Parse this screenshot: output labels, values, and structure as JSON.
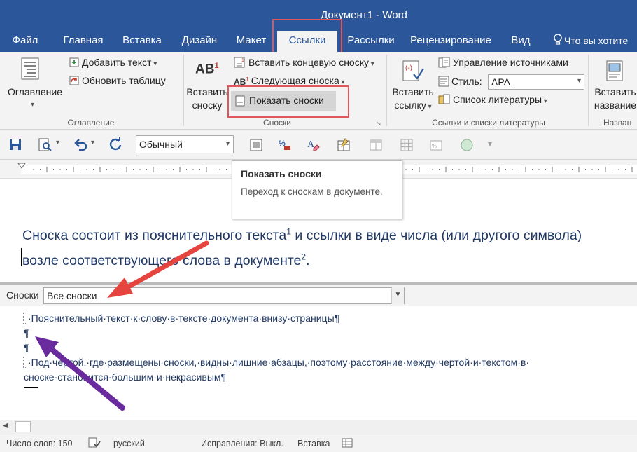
{
  "window": {
    "title": "Документ1 - Word"
  },
  "tabs": [
    "Файл",
    "Главная",
    "Вставка",
    "Дизайн",
    "Макет",
    "Ссылки",
    "Рассылки",
    "Рецензирование",
    "Вид"
  ],
  "tell_me": "Что вы хотите",
  "ribbon": {
    "toc": {
      "button": "Оглавление",
      "add_text": "Добавить текст",
      "update_table": "Обновить таблицу",
      "group": "Оглавление"
    },
    "footnotes": {
      "insert_line1": "Вставить",
      "insert_line2": "сноску",
      "insert_endnote": "Вставить концевую сноску",
      "next_footnote": "Следующая сноска",
      "show_notes": "Показать сноски",
      "group": "Сноски",
      "icon_text": "AB",
      "icon_sup": "1"
    },
    "citations": {
      "insert_line1": "Вставить",
      "insert_line2": "ссылку",
      "manage_sources": "Управление источниками",
      "style_label": "Стиль:",
      "style_value": "APA",
      "bibliography": "Список литературы",
      "group": "Ссылки и списки литературы"
    },
    "captions": {
      "insert_line1": "Вставить",
      "insert_line2": "название",
      "group": "Назван"
    }
  },
  "qat": {
    "style_value": "Обычный"
  },
  "tooltip": {
    "title": "Показать сноски",
    "description": "Переход к сноскам в документе."
  },
  "document": {
    "line1_a": "Сноска состоит из пояснительного текста",
    "sup1": "1",
    "line1_b": " и ссылки в виде числа (или другого символа)",
    "line2_a": "возле соответствующего слова в документе",
    "sup2": "2",
    "line2_b": "."
  },
  "footnotes_pane": {
    "label": "Сноски",
    "selected": "Все сноски",
    "line1": "·Пояснительный·текст·к·слову·в·тексте·документа·внизу·страницы¶",
    "para1": "¶",
    "para2": "¶",
    "line2": "·Под·чертой,·где·размещены·сноски,·видны·лишние·абзацы,·поэтому·расстояние·между·чертой·и·текстом·в·",
    "line3": "сноске·становится·большим·и·некрасивым¶"
  },
  "status": {
    "words": "Число слов: 150",
    "language": "русский",
    "track": "Исправления: Выкл.",
    "insert": "Вставка"
  },
  "colors": {
    "word_blue": "#2b579a",
    "highlight_red": "#e0565b",
    "arrow_red": "#e6453f",
    "arrow_purple": "#6a2b9e",
    "doc_text": "#1f3864"
  }
}
